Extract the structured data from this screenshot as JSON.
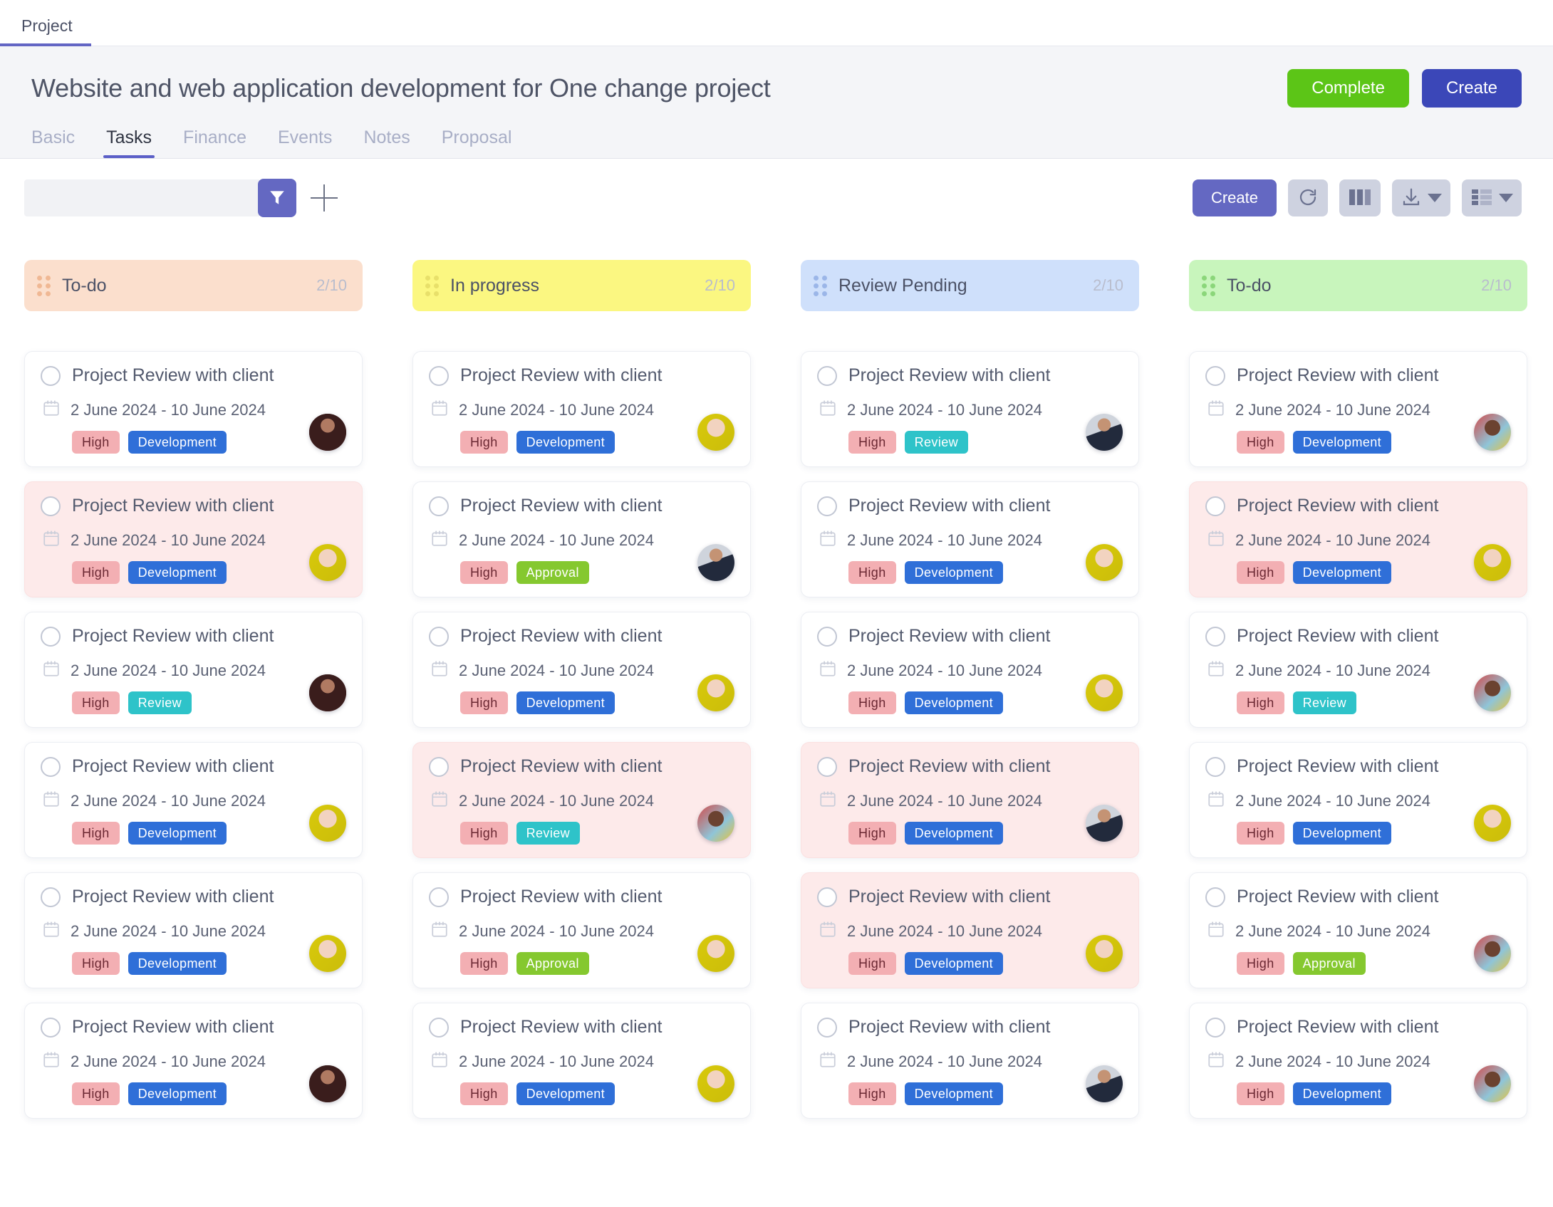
{
  "topbar": {
    "tab_label": "Project"
  },
  "header": {
    "title": "Website and web application development for One change project",
    "complete_label": "Complete",
    "create_label": "Create",
    "accent_color": "#5b5fc7",
    "complete_color": "#5cc517",
    "create_color": "#3b47b8",
    "tabs": [
      {
        "label": "Basic",
        "active": false
      },
      {
        "label": "Tasks",
        "active": true
      },
      {
        "label": "Finance",
        "active": false
      },
      {
        "label": "Events",
        "active": false
      },
      {
        "label": "Notes",
        "active": false
      },
      {
        "label": "Proposal",
        "active": false
      }
    ]
  },
  "toolbar": {
    "search_value": "",
    "search_placeholder": "",
    "filter_icon": "funnel-icon",
    "add_icon": "plus-icon",
    "create_label": "Create",
    "refresh_icon": "refresh-icon",
    "columns_icon": "columns-view-icon",
    "download_icon": "download-icon",
    "list_icon": "list-view-icon"
  },
  "board": {
    "columns": [
      {
        "title": "To-do",
        "count": "2/10",
        "header_bg": "#fbdfcd",
        "dot_color": "#f0b894",
        "cards": [
          {
            "title": "Project Review with client",
            "date": "2 June 2024 - 10 June 2024",
            "priority": "High",
            "category": "Development",
            "category_type": "development",
            "highlight": false,
            "avatar": "avatar-woman-dark-curly"
          },
          {
            "title": "Project Review with client",
            "date": "2 June 2024 - 10 June 2024",
            "priority": "High",
            "category": "Development",
            "category_type": "development",
            "highlight": true,
            "avatar": "avatar-woman-yellow-bg"
          },
          {
            "title": "Project Review with client",
            "date": "2 June 2024 - 10 June 2024",
            "priority": "High",
            "category": "Review",
            "category_type": "review",
            "highlight": false,
            "avatar": "avatar-woman-dark-curly"
          },
          {
            "title": "Project Review with client",
            "date": "2 June 2024 - 10 June 2024",
            "priority": "High",
            "category": "Development",
            "category_type": "development",
            "highlight": false,
            "avatar": "avatar-woman-yellow-bg"
          },
          {
            "title": "Project Review with client",
            "date": "2 June 2024 - 10 June 2024",
            "priority": "High",
            "category": "Development",
            "category_type": "development",
            "highlight": false,
            "avatar": "avatar-woman-yellow-bg"
          },
          {
            "title": "Project Review with client",
            "date": "2 June 2024 - 10 June 2024",
            "priority": "High",
            "category": "Development",
            "category_type": "development",
            "highlight": false,
            "avatar": "avatar-woman-dark-curly"
          }
        ]
      },
      {
        "title": "In progress",
        "count": "2/10",
        "header_bg": "#fbf781",
        "dot_color": "#e8e06a",
        "cards": [
          {
            "title": "Project Review with client",
            "date": "2 June 2024 - 10 June 2024",
            "priority": "High",
            "category": "Development",
            "category_type": "development",
            "highlight": false,
            "avatar": "avatar-woman-yellow-bg"
          },
          {
            "title": "Project Review with client",
            "date": "2 June 2024 - 10 June 2024",
            "priority": "High",
            "category": "Approval",
            "category_type": "approval",
            "highlight": false,
            "avatar": "avatar-man-suit"
          },
          {
            "title": "Project Review with client",
            "date": "2 June 2024 - 10 June 2024",
            "priority": "High",
            "category": "Development",
            "category_type": "development",
            "highlight": false,
            "avatar": "avatar-woman-yellow-bg"
          },
          {
            "title": "Project Review with client",
            "date": "2 June 2024 - 10 June 2024",
            "priority": "High",
            "category": "Review",
            "category_type": "review",
            "highlight": true,
            "avatar": "avatar-woman-bokeh-bg"
          },
          {
            "title": "Project Review with client",
            "date": "2 June 2024 - 10 June 2024",
            "priority": "High",
            "category": "Approval",
            "category_type": "approval",
            "highlight": false,
            "avatar": "avatar-woman-yellow-bg"
          },
          {
            "title": "Project Review with client",
            "date": "2 June 2024 - 10 June 2024",
            "priority": "High",
            "category": "Development",
            "category_type": "development",
            "highlight": false,
            "avatar": "avatar-woman-yellow-bg"
          }
        ]
      },
      {
        "title": "Review Pending",
        "count": "2/10",
        "header_bg": "#cfe0fb",
        "dot_color": "#9bb6e8",
        "cards": [
          {
            "title": "Project Review with client",
            "date": "2 June 2024 - 10 June 2024",
            "priority": "High",
            "category": "Review",
            "category_type": "review",
            "highlight": false,
            "avatar": "avatar-man-suit"
          },
          {
            "title": "Project Review with client",
            "date": "2 June 2024 - 10 June 2024",
            "priority": "High",
            "category": "Development",
            "category_type": "development",
            "highlight": false,
            "avatar": "avatar-woman-yellow-bg"
          },
          {
            "title": "Project Review with client",
            "date": "2 June 2024 - 10 June 2024",
            "priority": "High",
            "category": "Development",
            "category_type": "development",
            "highlight": false,
            "avatar": "avatar-woman-yellow-bg"
          },
          {
            "title": "Project Review with client",
            "date": "2 June 2024 - 10 June 2024",
            "priority": "High",
            "category": "Development",
            "category_type": "development",
            "highlight": true,
            "avatar": "avatar-man-suit"
          },
          {
            "title": "Project Review with client",
            "date": "2 June 2024 - 10 June 2024",
            "priority": "High",
            "category": "Development",
            "category_type": "development",
            "highlight": true,
            "avatar": "avatar-woman-yellow-bg"
          },
          {
            "title": "Project Review with client",
            "date": "2 June 2024 - 10 June 2024",
            "priority": "High",
            "category": "Development",
            "category_type": "development",
            "highlight": false,
            "avatar": "avatar-man-suit"
          }
        ]
      },
      {
        "title": "To-do",
        "count": "2/10",
        "header_bg": "#c8f5bc",
        "dot_color": "#8bd67a",
        "cards": [
          {
            "title": "Project Review with client",
            "date": "2 June 2024 - 10 June 2024",
            "priority": "High",
            "category": "Development",
            "category_type": "development",
            "highlight": false,
            "avatar": "avatar-woman-bokeh-bg"
          },
          {
            "title": "Project Review with client",
            "date": "2 June 2024 - 10 June 2024",
            "priority": "High",
            "category": "Development",
            "category_type": "development",
            "highlight": true,
            "avatar": "avatar-woman-yellow-bg"
          },
          {
            "title": "Project Review with client",
            "date": "2 June 2024 - 10 June 2024",
            "priority": "High",
            "category": "Review",
            "category_type": "review",
            "highlight": false,
            "avatar": "avatar-woman-bokeh-bg"
          },
          {
            "title": "Project Review with client",
            "date": "2 June 2024 - 10 June 2024",
            "priority": "High",
            "category": "Development",
            "category_type": "development",
            "highlight": false,
            "avatar": "avatar-woman-yellow-bg"
          },
          {
            "title": "Project Review with client",
            "date": "2 June 2024 - 10 June 2024",
            "priority": "High",
            "category": "Approval",
            "category_type": "approval",
            "highlight": false,
            "avatar": "avatar-woman-bokeh-bg"
          },
          {
            "title": "Project Review with client",
            "date": "2 June 2024 - 10 June 2024",
            "priority": "High",
            "category": "Development",
            "category_type": "development",
            "highlight": false,
            "avatar": "avatar-woman-bokeh-bg"
          }
        ]
      }
    ]
  }
}
